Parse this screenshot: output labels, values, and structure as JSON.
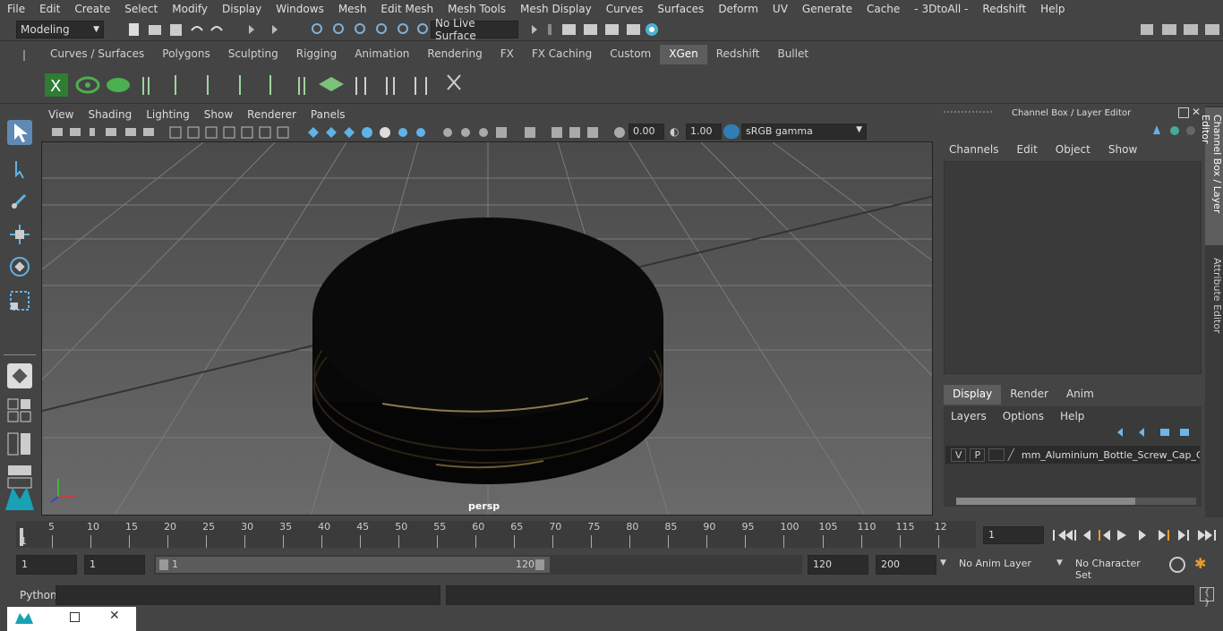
{
  "menubar": [
    "File",
    "Edit",
    "Create",
    "Select",
    "Modify",
    "Display",
    "Windows",
    "Mesh",
    "Edit Mesh",
    "Mesh Tools",
    "Mesh Display",
    "Curves",
    "Surfaces",
    "Deform",
    "UV",
    "Generate",
    "Cache",
    "- 3DtoAll -",
    "Redshift",
    "Help"
  ],
  "status": {
    "mode": "Modeling",
    "live_surface": "No Live Surface"
  },
  "shelf": {
    "tabs": [
      "Curves / Surfaces",
      "Polygons",
      "Sculpting",
      "Rigging",
      "Animation",
      "Rendering",
      "FX",
      "FX Caching",
      "Custom",
      "XGen",
      "Redshift",
      "Bullet"
    ],
    "active": "XGen"
  },
  "viewport": {
    "menus": [
      "View",
      "Shading",
      "Lighting",
      "Show",
      "Renderer",
      "Panels"
    ],
    "exposure": "0.00",
    "gamma": "1.00",
    "colorspace": "sRGB gamma",
    "camera_label": "persp"
  },
  "channelbox": {
    "title": "Channel Box / Layer Editor",
    "menus": [
      "Channels",
      "Edit",
      "Object",
      "Show"
    ]
  },
  "layers": {
    "tabs": [
      "Display",
      "Render",
      "Anim"
    ],
    "active": "Display",
    "menus": [
      "Layers",
      "Options",
      "Help"
    ],
    "row": {
      "v": "V",
      "p": "P",
      "name": "mm_Aluminium_Bottle_Screw_Cap_Gc"
    }
  },
  "sidetabs": {
    "channel": "Channel Box / Layer Editor",
    "attr": "Attribute Editor"
  },
  "timeline": {
    "ticks": [
      "5",
      "10",
      "15",
      "20",
      "25",
      "30",
      "35",
      "40",
      "45",
      "50",
      "55",
      "60",
      "65",
      "70",
      "75",
      "80",
      "85",
      "90",
      "95",
      "100",
      "105",
      "110",
      "115",
      "12"
    ],
    "first": "1",
    "current_frame": "1"
  },
  "range": {
    "start": "1",
    "current": "1",
    "slider_start": "1",
    "slider_end": "120",
    "end": "120",
    "max": "200",
    "anim_layer": "No Anim Layer",
    "char_set": "No Character Set"
  },
  "cmd": {
    "label": "Python"
  }
}
